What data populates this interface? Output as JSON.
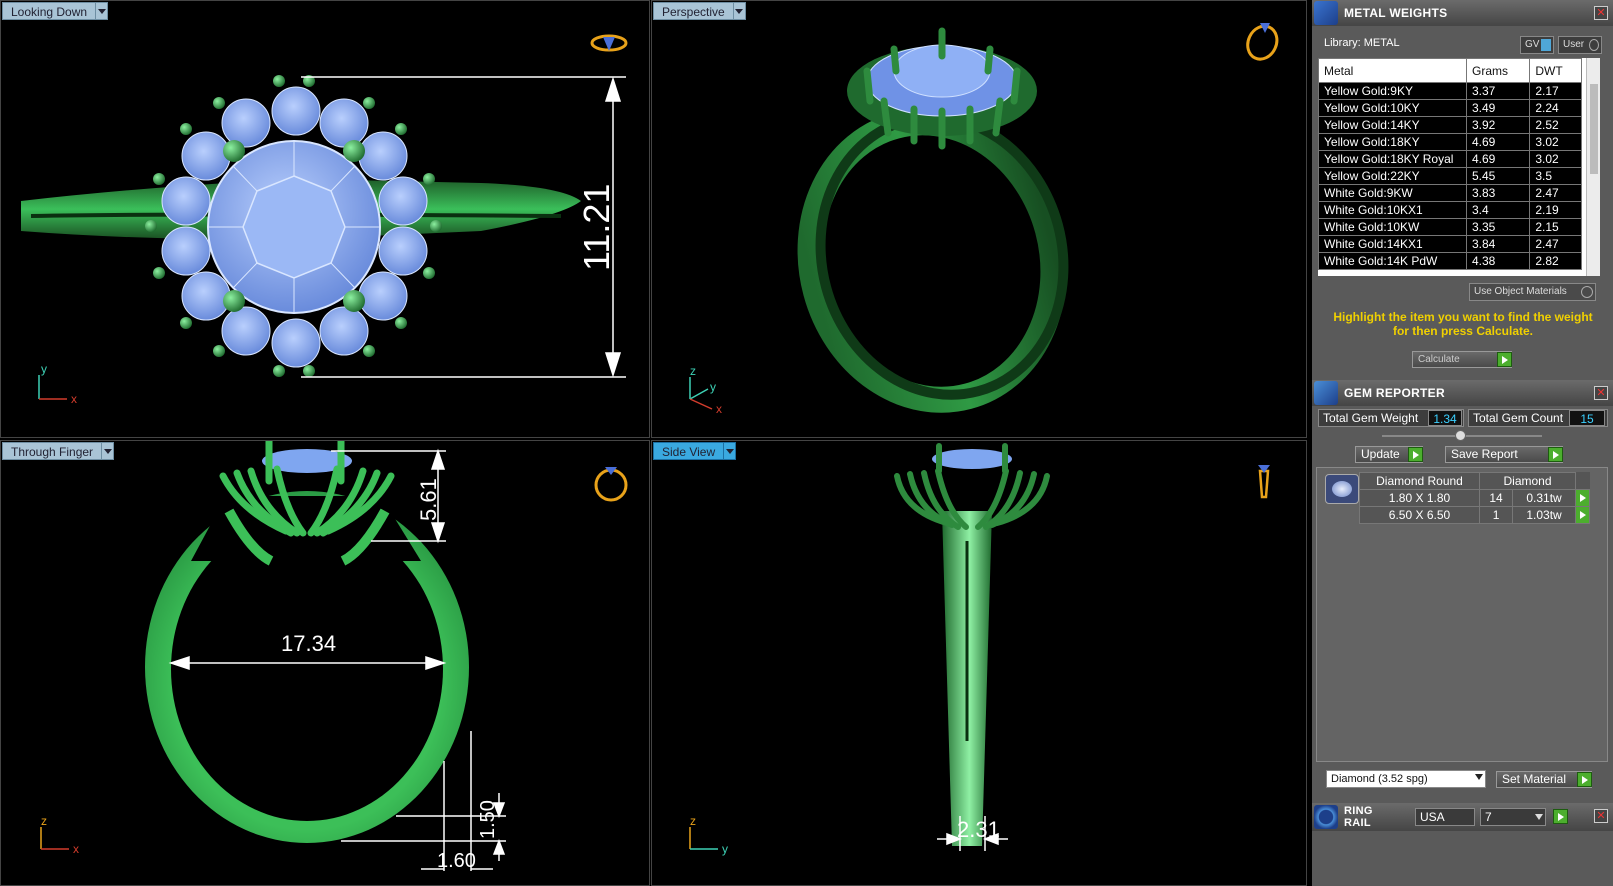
{
  "viewports": {
    "top_left": {
      "label": "Looking Down",
      "active": false,
      "dimension": "11.21",
      "axes": {
        "a": "y",
        "b": "x"
      }
    },
    "top_right": {
      "label": "Perspective",
      "active": false,
      "axes": {
        "a": "z",
        "b": "y",
        "c": "x"
      }
    },
    "bottom_left": {
      "label": "Through Finger",
      "active": false,
      "dimensions": [
        "5.61",
        "17.34",
        "1.50",
        "1.60"
      ],
      "axes": {
        "a": "z",
        "b": "x"
      }
    },
    "bottom_right": {
      "label": "Side View",
      "active": true,
      "dimension": "2.31",
      "axes": {
        "a": "z",
        "b": "y"
      }
    }
  },
  "metal_weights": {
    "title": "METAL WEIGHTS",
    "library_label": "Library: METAL",
    "gv_label": "GV",
    "user_label": "User",
    "columns": [
      "Metal",
      "Grams",
      "DWT"
    ],
    "rows": [
      {
        "metal": "Yellow Gold:9KY",
        "grams": "3.37",
        "dwt": "2.17"
      },
      {
        "metal": "Yellow Gold:10KY",
        "grams": "3.49",
        "dwt": "2.24"
      },
      {
        "metal": "Yellow Gold:14KY",
        "grams": "3.92",
        "dwt": "2.52"
      },
      {
        "metal": "Yellow Gold:18KY",
        "grams": "4.69",
        "dwt": "3.02"
      },
      {
        "metal": "Yellow Gold:18KY Royal",
        "grams": "4.69",
        "dwt": "3.02"
      },
      {
        "metal": "Yellow Gold:22KY",
        "grams": "5.45",
        "dwt": "3.5"
      },
      {
        "metal": "White Gold:9KW",
        "grams": "3.83",
        "dwt": "2.47"
      },
      {
        "metal": "White Gold:10KX1",
        "grams": "3.4",
        "dwt": "2.19"
      },
      {
        "metal": "White Gold:10KW",
        "grams": "3.35",
        "dwt": "2.15"
      },
      {
        "metal": "White Gold:14KX1",
        "grams": "3.84",
        "dwt": "2.47"
      },
      {
        "metal": "White Gold:14K PdW",
        "grams": "4.38",
        "dwt": "2.82"
      }
    ],
    "use_object_materials": "Use Object Materials",
    "instruction": "Highlight the item you want to find the weight for then press Calculate.",
    "calculate_label": "Calculate",
    "accent": "#f0d000"
  },
  "gem_reporter": {
    "title": "GEM REPORTER",
    "total_weight_label": "Total Gem Weight",
    "total_weight_value": "1.34",
    "total_count_label": "Total Gem Count",
    "total_count_value": "15",
    "update_label": "Update",
    "save_label": "Save Report",
    "header": {
      "cut": "Diamond Round",
      "material": "Diamond"
    },
    "rows": [
      {
        "size": "1.80 X 1.80",
        "count": "14",
        "weight": "0.31tw"
      },
      {
        "size": "6.50 X 6.50",
        "count": "1",
        "weight": "1.03tw"
      }
    ],
    "material_select": "Diamond    (3.52 spg)",
    "set_material_label": "Set Material"
  },
  "ring_rail": {
    "title": "RING RAIL",
    "region": "USA",
    "size": "7"
  },
  "colors": {
    "metal": "#2e8b3e",
    "metal_light": "#55d072",
    "gem": "#7fa6f0",
    "gem_line": "#cfe0ff",
    "icon_gold": "#e8a21a"
  }
}
